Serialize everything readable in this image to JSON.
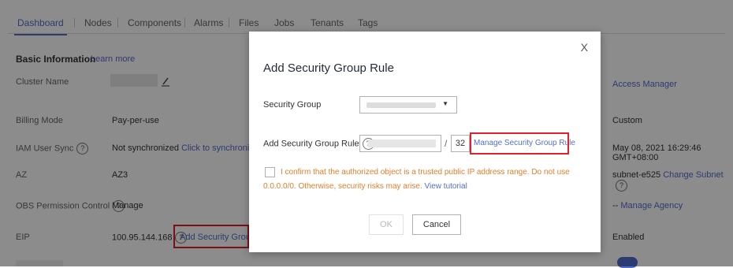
{
  "tabs": [
    "Dashboard",
    "Nodes",
    "Components",
    "Alarms",
    "Files",
    "Jobs",
    "Tenants",
    "Tags"
  ],
  "basic_info": {
    "title": "Basic Information",
    "learn_more": "Learn more"
  },
  "rows": {
    "cluster_name_label": "Cluster Name",
    "billing_mode_label": "Billing Mode",
    "billing_mode_value": "Pay-per-use",
    "iam_label": "IAM User Sync",
    "iam_value": "Not synchronized",
    "iam_link": "Click to synchronize",
    "az_label": "AZ",
    "az_value": "AZ3",
    "obs_label": "OBS Permission Control",
    "obs_value": "Manage",
    "eip_label": "EIP",
    "eip_value": "100.95.144.168",
    "eip_link": "Add Security Group Rule"
  },
  "right_column": {
    "access_manager": "Access Manager",
    "custom": "Custom",
    "date": "May 08, 2021 16:29:46 GMT+08:00",
    "subnet": "subnet-e525",
    "change_subnet": "Change Subnet",
    "manage_agency_prefix": "--",
    "manage_agency": "Manage Agency",
    "enabled": "Enabled"
  },
  "modal": {
    "close": "X",
    "title": "Add Security Group Rule",
    "security_group_label": "Security Group",
    "add_rule_label": "Add Security Group Rule",
    "mask_value": "32",
    "slash": "/",
    "manage_rule_link": "Manage Security Group Rule",
    "warning_text": "I confirm that the authorized object is a trusted public IP address range. Do not use 0.0.0.0/0. Otherwise, security risks may arise.",
    "view_tutorial": "View tutorial",
    "ok": "OK",
    "cancel": "Cancel"
  },
  "icons": {
    "help": "?",
    "edit": "pencil-icon",
    "caret": "▼"
  },
  "colors": {
    "accent": "#526ecc",
    "warning": "#e37d29",
    "highlight": "#e0202b"
  }
}
